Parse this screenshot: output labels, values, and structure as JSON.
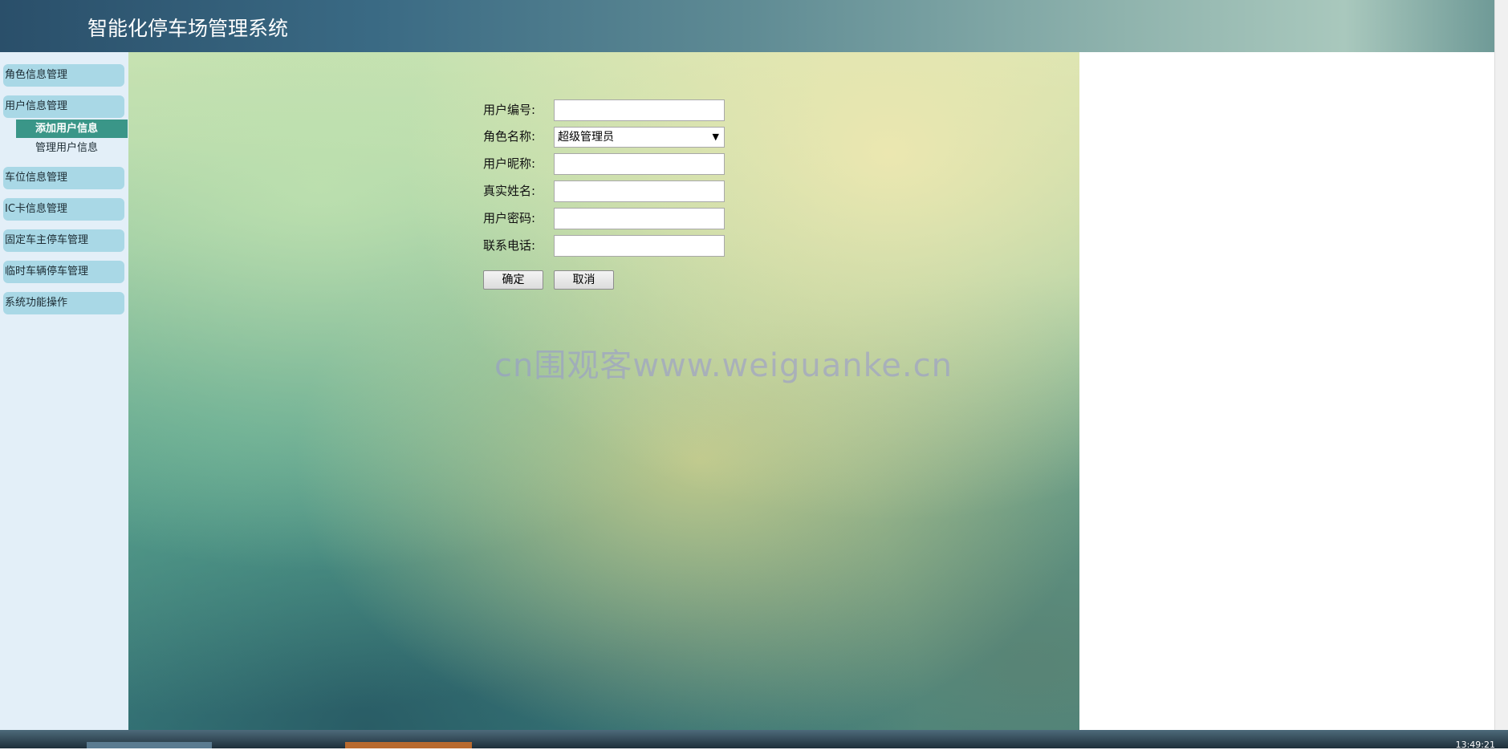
{
  "header": {
    "title": "智能化停车场管理系统"
  },
  "sidebar": {
    "groups": [
      {
        "label": "角色信息管理"
      },
      {
        "label": "用户信息管理",
        "children": [
          {
            "label": "添加用户信息",
            "active": true
          },
          {
            "label": "管理用户信息",
            "active": false
          }
        ]
      },
      {
        "label": "车位信息管理"
      },
      {
        "label": "IC卡信息管理"
      },
      {
        "label": "固定车主停车管理"
      },
      {
        "label": "临时车辆停车管理"
      },
      {
        "label": "系统功能操作"
      }
    ]
  },
  "form": {
    "user_id_label": "用户编号:",
    "user_id_value": "",
    "role_label": "角色名称:",
    "role_selected": "超级管理员",
    "nickname_label": "用户昵称:",
    "nickname_value": "",
    "realname_label": "真实姓名:",
    "realname_value": "",
    "password_label": "用户密码:",
    "password_value": "",
    "phone_label": "联系电话:",
    "phone_value": "",
    "confirm_label": "确定",
    "cancel_label": "取消"
  },
  "watermark": "cn围观客www.weiguanke.cn",
  "taskbar": {
    "clock": "13:49:21"
  },
  "colors": {
    "sidebar_group_bg": "#a9d8e6",
    "sidebar_active_bg": "#3a9688",
    "sidebar_bg": "#e3eff8"
  }
}
